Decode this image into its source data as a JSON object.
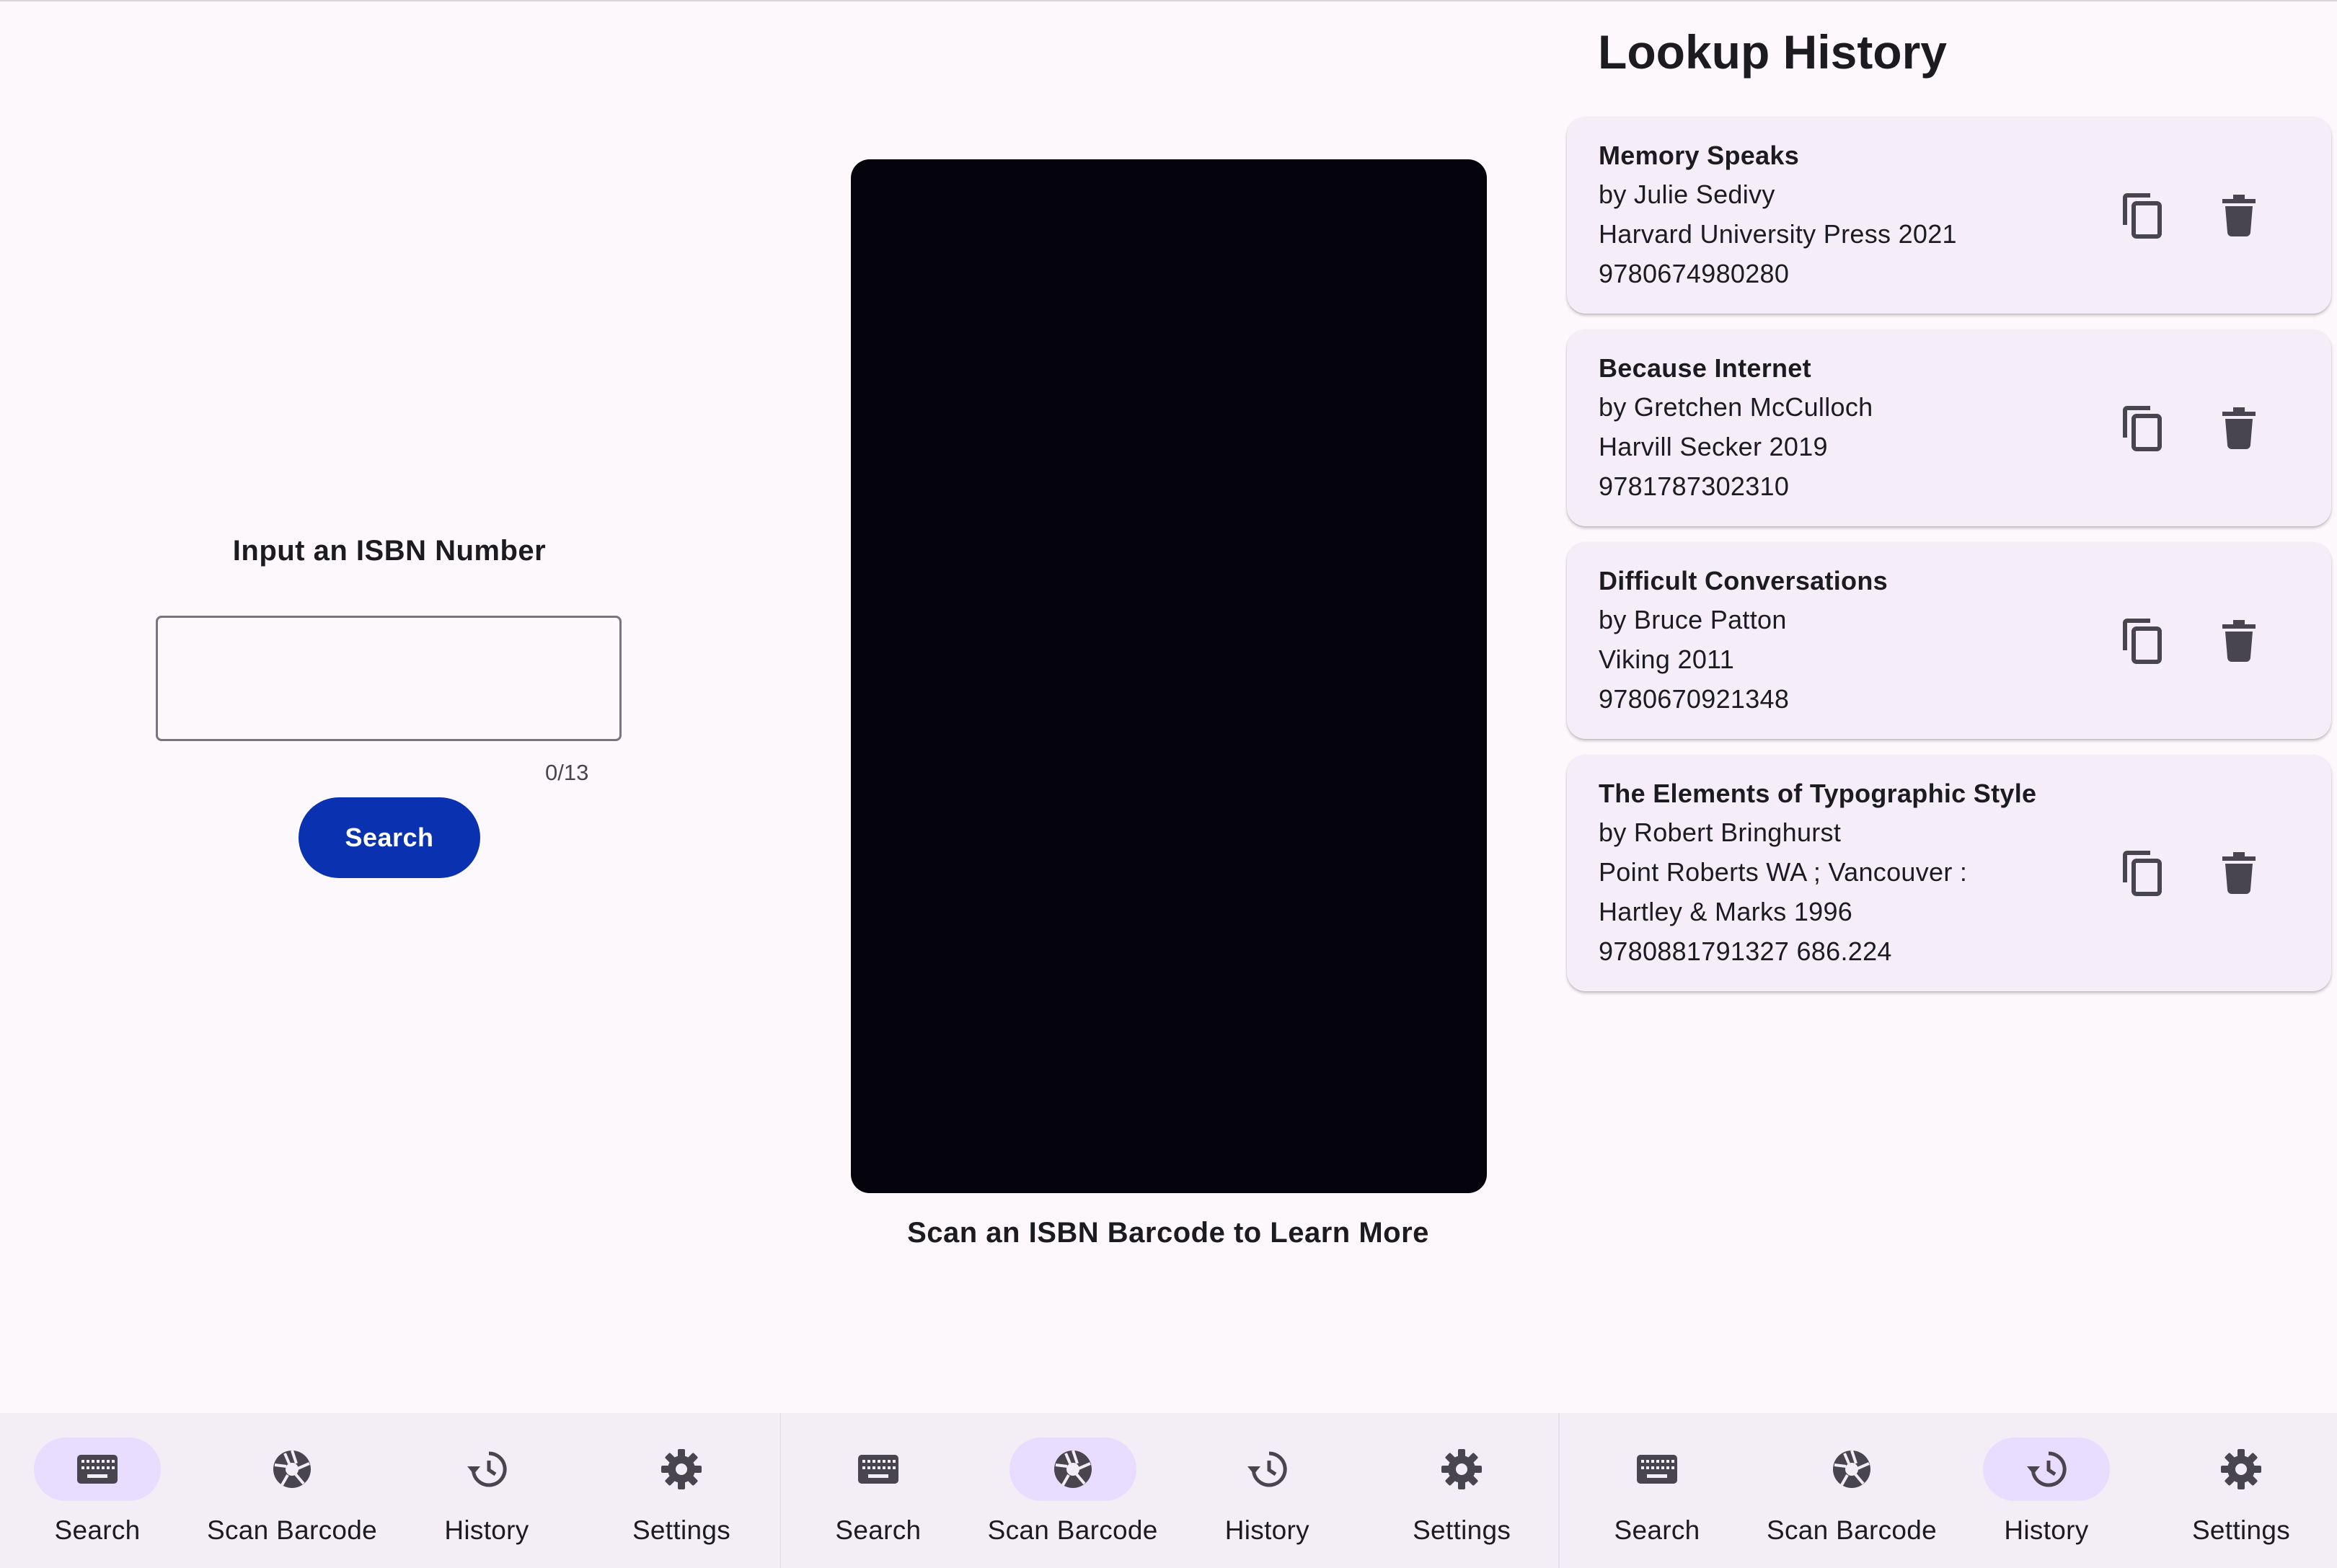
{
  "search_panel": {
    "label": "Input an ISBN Number",
    "input_value": "",
    "counter": "0/13",
    "button_label": "Search"
  },
  "scan_panel": {
    "caption": "Scan an ISBN Barcode to Learn More"
  },
  "history_panel": {
    "title": "Lookup History",
    "items": [
      {
        "title": "Memory Speaks",
        "author": "by Julie Sedivy",
        "publisher_lines": [
          "Harvard University Press 2021"
        ],
        "isbn": "9780674980280"
      },
      {
        "title": "Because Internet",
        "author": "by Gretchen McCulloch",
        "publisher_lines": [
          "Harvill Secker 2019"
        ],
        "isbn": "9781787302310"
      },
      {
        "title": "Difficult Conversations",
        "author": "by Bruce Patton",
        "publisher_lines": [
          "Viking 2011"
        ],
        "isbn": "9780670921348"
      },
      {
        "title": "The Elements of Typographic Style",
        "author": "by Robert Bringhurst",
        "publisher_lines": [
          "Point Roberts WA ; Vancouver :",
          "Hartley & Marks 1996"
        ],
        "isbn": "9780881791327 686.224"
      }
    ],
    "item_actions": {
      "copy_icon": "copy-icon",
      "delete_icon": "delete-icon"
    }
  },
  "nav_bars": [
    {
      "active": "Search",
      "items": [
        {
          "label": "Search",
          "icon": "keyboard-icon"
        },
        {
          "label": "Scan Barcode",
          "icon": "camera-shutter-icon"
        },
        {
          "label": "History",
          "icon": "history-icon"
        },
        {
          "label": "Settings",
          "icon": "gear-icon"
        }
      ]
    },
    {
      "active": "Scan Barcode",
      "items": [
        {
          "label": "Search",
          "icon": "keyboard-icon"
        },
        {
          "label": "Scan Barcode",
          "icon": "camera-shutter-icon"
        },
        {
          "label": "History",
          "icon": "history-icon"
        },
        {
          "label": "Settings",
          "icon": "gear-icon"
        }
      ]
    },
    {
      "active": "History",
      "items": [
        {
          "label": "Search",
          "icon": "keyboard-icon"
        },
        {
          "label": "Scan Barcode",
          "icon": "camera-shutter-icon"
        },
        {
          "label": "History",
          "icon": "history-icon"
        },
        {
          "label": "Settings",
          "icon": "gear-icon"
        }
      ]
    }
  ],
  "colors": {
    "background": "#fdf8fc",
    "primary_button": "#0a32b0",
    "active_indicator": "#e9ddff",
    "card": "#f5eef8",
    "nav_bar": "#f3edf6",
    "camera": "#05030c",
    "icon": "#49454f"
  }
}
